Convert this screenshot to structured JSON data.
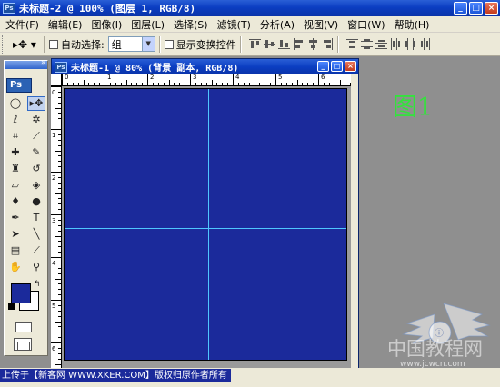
{
  "app": {
    "title": "未标题-2 @ 100% (图层 1, RGB/8)",
    "ps_badge": "Ps",
    "window_buttons": [
      "_",
      "□",
      "×"
    ]
  },
  "menu": {
    "items": [
      "文件(F)",
      "编辑(E)",
      "图像(I)",
      "图层(L)",
      "选择(S)",
      "滤镜(T)",
      "分析(A)",
      "视图(V)",
      "窗口(W)",
      "帮助(H)"
    ]
  },
  "options": {
    "tool_icon": "move-tool-icon",
    "auto_select_label": "自动选择:",
    "auto_select_value": "组",
    "show_transform_label": "显示变换控件"
  },
  "toolbox": {
    "logo": "Ps",
    "tools": [
      "marquee-icon",
      "move-icon",
      "lasso-icon",
      "magic-wand-icon",
      "crop-icon",
      "slice-icon",
      "healing-brush-icon",
      "brush-icon",
      "stamp-icon",
      "history-brush-icon",
      "eraser-icon",
      "bucket-icon",
      "blur-icon",
      "dodge-icon",
      "pen-icon",
      "type-icon",
      "path-select-icon",
      "line-icon",
      "notes-icon",
      "eyedropper-icon",
      "hand-icon",
      "zoom-icon"
    ],
    "fg_color": "#1b2a9b",
    "bg_color": "#ffffff"
  },
  "document": {
    "title": "未标题-1 @ 80% (背景 副本, RGB/8)",
    "canvas_color": "#1b2a9b",
    "guide_color": "#4fc6ff",
    "ruler_h_labels": [
      "0",
      "1",
      "2",
      "3",
      "4",
      "5",
      "6"
    ],
    "ruler_v_labels": [
      "0",
      "1",
      "2",
      "3",
      "4",
      "5",
      "6"
    ]
  },
  "caption": "上传于【新客网 WWW.XKER.COM】版权归原作者所有",
  "figure_label": "图1",
  "watermark": {
    "text": "中国教程网",
    "url": "www.jcwcn.com"
  }
}
